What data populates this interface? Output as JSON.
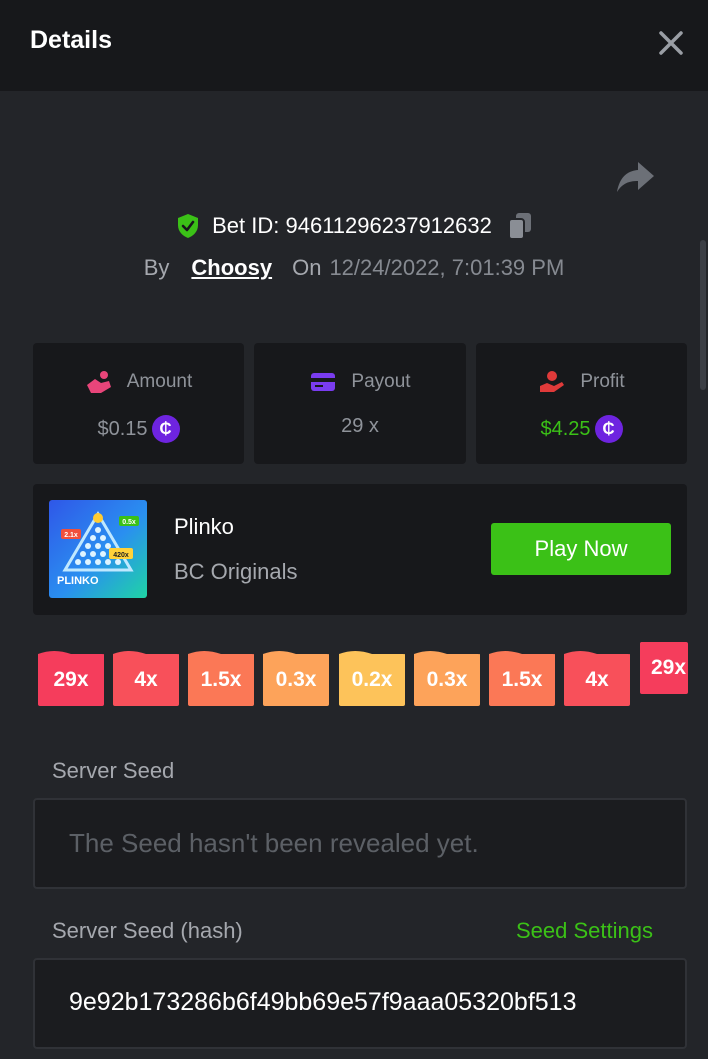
{
  "header": {
    "title": "Details"
  },
  "bet": {
    "id_label": "Bet ID: 94611296237912632",
    "by_label": "By",
    "username": "Choosy",
    "on_label": "On",
    "date": "12/24/2022, 7:01:39 PM"
  },
  "stats": {
    "amount": {
      "label": "Amount",
      "value": "$0.15",
      "color": "#e8457a"
    },
    "payout": {
      "label": "Payout",
      "value": "29 x",
      "color": "#7a3cf0"
    },
    "profit": {
      "label": "Profit",
      "value": "$4.25",
      "color": "#e03a3a",
      "value_color": "#3bc117"
    }
  },
  "game": {
    "name": "Plinko",
    "provider": "BC Originals",
    "play_label": "Play Now",
    "thumb_text": "PLINKO",
    "thumb_tags": [
      "2.1x",
      "0.5x",
      "420x"
    ]
  },
  "multipliers": [
    {
      "label": "29x",
      "color": "#f53d5c"
    },
    {
      "label": "4x",
      "color": "#f8505a"
    },
    {
      "label": "1.5x",
      "color": "#fb7856"
    },
    {
      "label": "0.3x",
      "color": "#fda35a"
    },
    {
      "label": "0.2x",
      "color": "#fdc35a"
    },
    {
      "label": "0.3x",
      "color": "#fda35a"
    },
    {
      "label": "1.5x",
      "color": "#fb7856"
    },
    {
      "label": "4x",
      "color": "#f8505a"
    },
    {
      "label": "29x",
      "color": "#f53d5c"
    }
  ],
  "server_seed": {
    "label": "Server Seed",
    "placeholder": "The Seed hasn't been revealed yet."
  },
  "server_seed_hash": {
    "label": "Server Seed (hash)",
    "settings_link": "Seed Settings",
    "value": "9e92b173286b6f49bb69e57f9aaa05320bf513"
  },
  "colors": {
    "accent_green": "#3bc117",
    "coin": "#6e24e0"
  }
}
